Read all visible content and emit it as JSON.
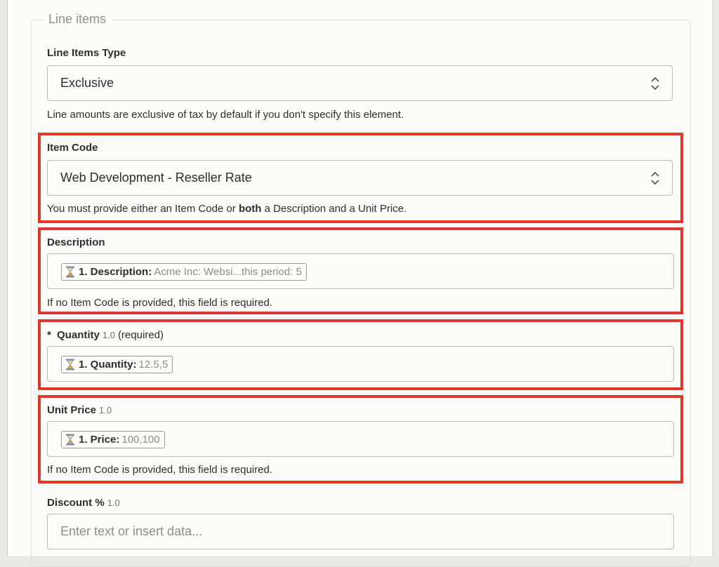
{
  "section": {
    "legend": "Line items"
  },
  "line_items_type": {
    "label": "Line Items Type",
    "value": "Exclusive",
    "help": "Line amounts are exclusive of tax by default if you don't specify this element."
  },
  "item_code": {
    "label": "Item Code",
    "value": "Web Development - Reseller Rate",
    "help_pre": "You must provide either an Item Code or ",
    "help_bold": "both",
    "help_post": " a Description and a Unit Price."
  },
  "description": {
    "label": "Description",
    "pill_key": "1. Description:",
    "pill_value": "Acme Inc: Websi...this period: 5",
    "help": "If no Item Code is provided, this field is required."
  },
  "quantity": {
    "asterisk": "*",
    "label": "Quantity",
    "version": "1.0",
    "required": "(required)",
    "pill_key": "1. Quantity:",
    "pill_value": "12.5,5"
  },
  "unit_price": {
    "label": "Unit Price",
    "version": "1.0",
    "pill_key": "1. Price:",
    "pill_value": "100,100",
    "help": "If no Item Code is provided, this field is required."
  },
  "discount": {
    "label": "Discount %",
    "version": "1.0",
    "placeholder": "Enter text or insert data..."
  },
  "icons": {
    "chevron": "chevron-up-down-icon",
    "pill": "hourglass-icon"
  },
  "colors": {
    "highlight": "#e0392b",
    "background": "#fdfcf8",
    "text": "#2d2e2e",
    "muted": "#8f8d88"
  }
}
